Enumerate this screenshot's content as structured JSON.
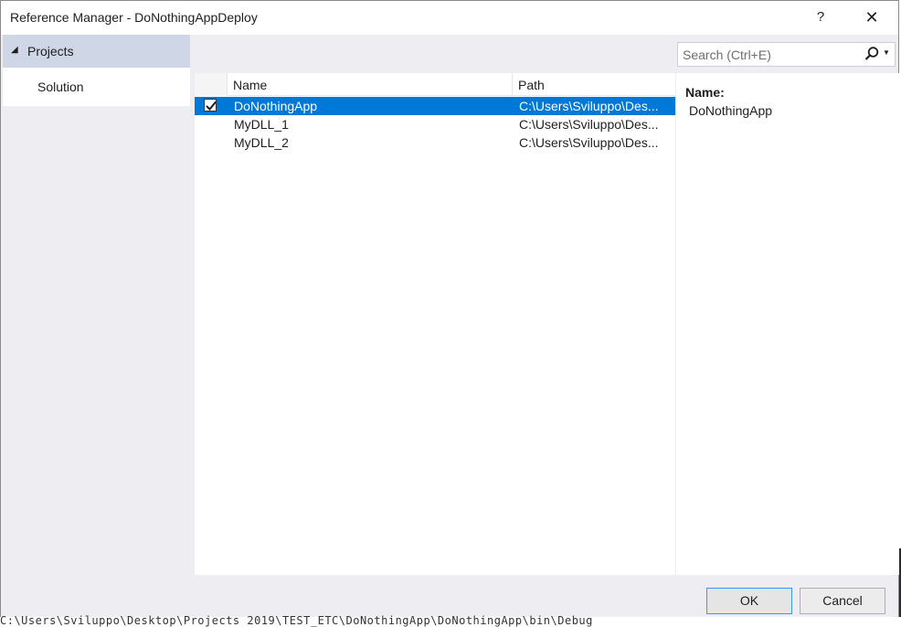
{
  "window": {
    "title": "Reference Manager - DoNothingAppDeploy",
    "help_label": "?",
    "close_label": "✕"
  },
  "sidebar": {
    "header": "Projects",
    "items": [
      {
        "label": "Solution"
      }
    ]
  },
  "search": {
    "placeholder": "Search (Ctrl+E)",
    "value": ""
  },
  "list": {
    "columns": [
      "Name",
      "Path"
    ],
    "rows": [
      {
        "checked": true,
        "selected": true,
        "name": "DoNothingApp",
        "path": "C:\\Users\\Sviluppo\\Des..."
      },
      {
        "checked": false,
        "selected": false,
        "name": "MyDLL_1",
        "path": "C:\\Users\\Sviluppo\\Des..."
      },
      {
        "checked": false,
        "selected": false,
        "name": "MyDLL_2",
        "path": "C:\\Users\\Sviluppo\\Des..."
      }
    ]
  },
  "details": {
    "label": "Name:",
    "value": "DoNothingApp"
  },
  "footer": {
    "ok_label": "OK",
    "cancel_label": "Cancel"
  },
  "background": {
    "partial_text": "C:\\Users\\Sviluppo\\Desktop\\Projects 2019\\TEST_ETC\\DoNothingApp\\DoNothingApp\\bin\\Debug"
  },
  "colors": {
    "accent": "#0078d7",
    "sidebar_selected": "#cfd6e5",
    "dialog_bg": "#eeeef2",
    "ok_border": "#3399ff"
  },
  "icons": {
    "search": "search-icon",
    "dropdown": "chevron-down-icon",
    "collapse": "collapse-triangle-icon",
    "checkbox": "checkbox-checked-icon"
  }
}
